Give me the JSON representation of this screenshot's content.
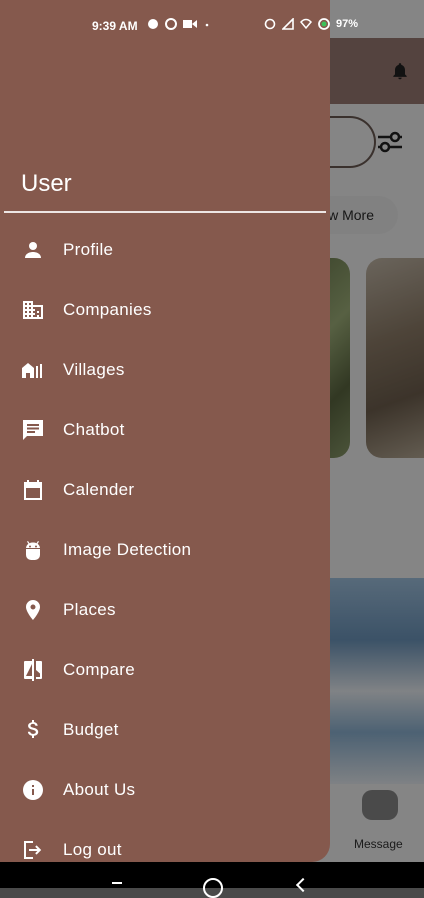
{
  "status_bar": {
    "time": "9:39 AM",
    "battery": "97%"
  },
  "drawer": {
    "header_label": "User",
    "items": [
      {
        "label": "Profile",
        "icon": "person-icon"
      },
      {
        "label": "Companies",
        "icon": "building-icon"
      },
      {
        "label": "Villages",
        "icon": "village-icon"
      },
      {
        "label": "Chatbot",
        "icon": "chat-icon"
      },
      {
        "label": "Calender",
        "icon": "calendar-icon"
      },
      {
        "label": "Image Detection",
        "icon": "android-icon"
      },
      {
        "label": "Places",
        "icon": "location-pin-icon"
      },
      {
        "label": "Compare",
        "icon": "compare-icon"
      },
      {
        "label": "Budget",
        "icon": "dollar-icon"
      },
      {
        "label": "About Us",
        "icon": "info-icon"
      },
      {
        "label": "Log out",
        "icon": "logout-icon"
      }
    ]
  },
  "background": {
    "view_more_label": "w More",
    "message_label": "Message"
  },
  "colors": {
    "drawer_bg": "#85594d",
    "text": "#ffffff"
  }
}
